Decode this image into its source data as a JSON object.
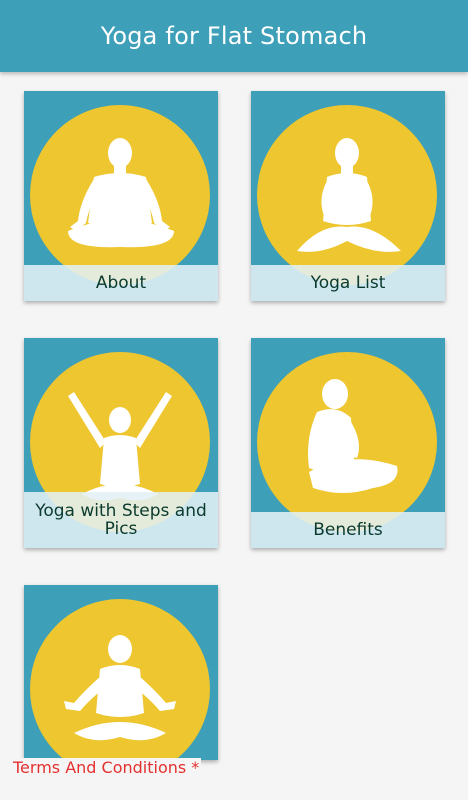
{
  "app_bar": {
    "title": "Yoga for Flat Stomach"
  },
  "colors": {
    "app_bar": "#3d9fb8",
    "card_bg": "#3d9fb8",
    "circle": "#eec62f",
    "label_bg": "#e2f0f4",
    "label_text": "#0b3a2e",
    "terms_text": "#e53030"
  },
  "menu": {
    "items": [
      {
        "label": "About",
        "icon": "meditation-pose-icon"
      },
      {
        "label": "Yoga List",
        "icon": "seated-pose-icon"
      },
      {
        "label": "Yoga with Steps and Pics",
        "icon": "arms-raised-pose-icon"
      },
      {
        "label": "Benefits",
        "icon": "side-seated-pose-icon"
      },
      {
        "label": "",
        "icon": "lotus-pose-icon"
      }
    ]
  },
  "footer": {
    "terms_link": "Terms And Conditions *"
  }
}
